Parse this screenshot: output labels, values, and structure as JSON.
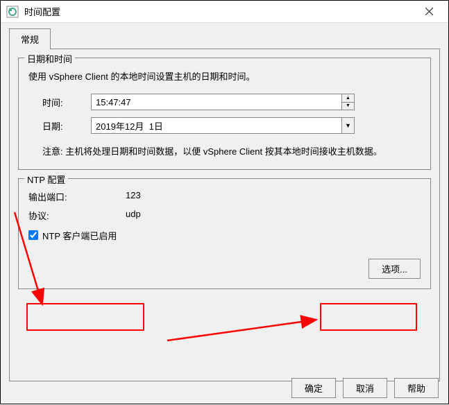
{
  "window": {
    "title": "时间配置"
  },
  "tab": {
    "general": "常规"
  },
  "datetime_section": {
    "legend": "日期和时间",
    "description": "使用 vSphere Client 的本地时间设置主机的日期和时间。",
    "time_label": "时间:",
    "time_value": "15:47:47",
    "date_label": "日期:",
    "date_value": "2019年12月  1日",
    "note": "注意: 主机将处理日期和时间数据，以便 vSphere Client 按其本地时间接收主机数据。"
  },
  "ntp_section": {
    "legend": "NTP 配置",
    "outgoing_port_label": "输出端口:",
    "outgoing_port_value": "123",
    "protocol_label": "协议:",
    "protocol_value": "udp",
    "ntp_client_enabled_label": "NTP 客户端已启用",
    "ntp_client_enabled": true,
    "options_button": "选项..."
  },
  "buttons": {
    "ok": "确定",
    "cancel": "取消",
    "help": "帮助"
  }
}
